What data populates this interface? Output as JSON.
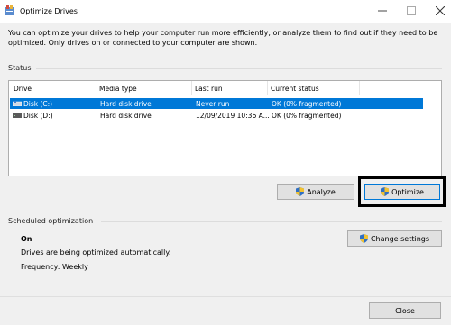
{
  "window": {
    "title": "Optimize Drives",
    "minimize_glyph": "—",
    "maximize_glyph": "☐",
    "close_glyph": "✕"
  },
  "description": "You can optimize your drives to help your computer run more efficiently, or analyze them to find out if they need to be optimized. Only drives on or connected to your computer are shown.",
  "status": {
    "label": "Status",
    "columns": [
      "Drive",
      "Media type",
      "Last run",
      "Current status"
    ],
    "rows": [
      {
        "drive": "Disk (C:)",
        "media_type": "Hard disk drive",
        "last_run": "Never run",
        "current_status": "OK (0% fragmented)",
        "selected": true,
        "icon": "system-drive-icon"
      },
      {
        "drive": "Disk (D:)",
        "media_type": "Hard disk drive",
        "last_run": "12/09/2019 10:36 A...",
        "current_status": "OK (0% fragmented)",
        "selected": false,
        "icon": "hard-drive-icon"
      }
    ],
    "analyze_label": "Analyze",
    "optimize_label": "Optimize"
  },
  "scheduled": {
    "label": "Scheduled optimization",
    "state": "On",
    "message": "Drives are being optimized automatically.",
    "frequency": "Frequency: Weekly",
    "change_settings_label": "Change settings"
  },
  "footer": {
    "close_label": "Close"
  },
  "colors": {
    "selection": "#0078d7",
    "background": "#f0f0f0",
    "highlight_box": "#000000"
  }
}
